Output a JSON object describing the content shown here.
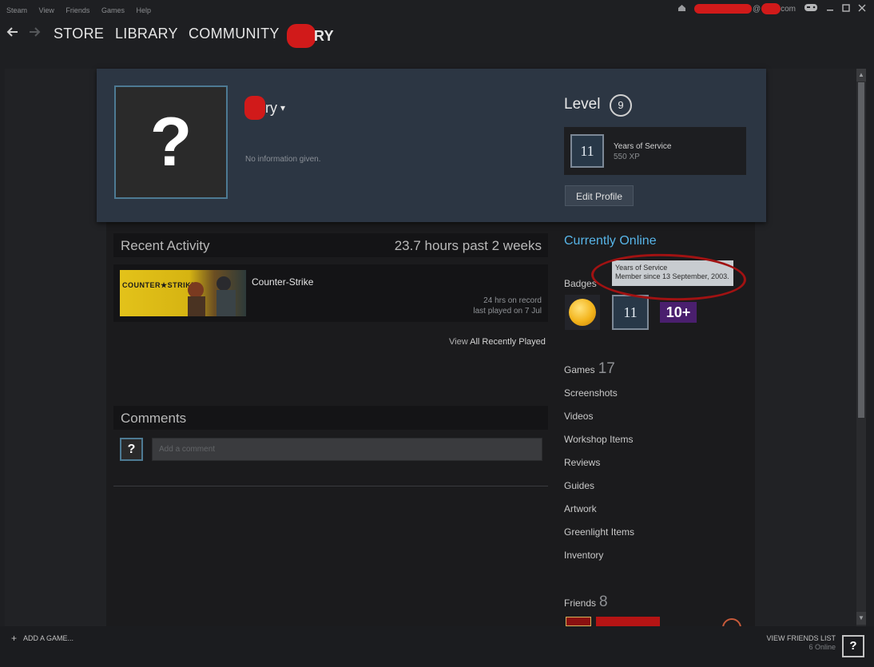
{
  "menu": {
    "items": [
      "Steam",
      "View",
      "Friends",
      "Games",
      "Help"
    ]
  },
  "titlebar": {
    "account_suffix": "com"
  },
  "nav": {
    "store": "STORE",
    "library": "LIBRARY",
    "community": "COMMUNITY",
    "profile_suffix": "RY"
  },
  "profile": {
    "avatar_glyph": "?",
    "persona_suffix": "ry",
    "dropdown_glyph": "▾",
    "info": "No information given.",
    "level_label": "Level",
    "level_value": "9",
    "badge": {
      "icon_text": "11",
      "name": "Years of Service",
      "xp": "550 XP"
    },
    "edit_button": "Edit Profile"
  },
  "recent_activity": {
    "title": "Recent Activity",
    "summary": "23.7 hours past 2 weeks",
    "games": [
      {
        "logo_text": "COUNTER★STRIKE",
        "name": "Counter-Strike",
        "hours": "24 hrs on record",
        "last_played": "last played on 7 Jul"
      }
    ],
    "view_prefix": "View",
    "view_link": "All Recently Played"
  },
  "comments": {
    "title": "Comments",
    "avatar_glyph": "?",
    "placeholder": "Add a comment"
  },
  "sidebar": {
    "status": "Currently Online",
    "badges_label": "Badges",
    "tooltip_line1": "Years of Service",
    "tooltip_line2": "Member since 13 September, 2003.",
    "badge_years": "11",
    "badge_tenplus": "10+",
    "games_label": "Games",
    "games_count": "17",
    "links": [
      "Screenshots",
      "Videos",
      "Workshop Items",
      "Reviews",
      "Guides",
      "Artwork",
      "Greenlight Items",
      "Inventory"
    ],
    "friends_label": "Friends",
    "friends_count": "8"
  },
  "bottom": {
    "add_game": "ADD A GAME...",
    "add_icon": "+",
    "view_friends": "VIEW FRIENDS LIST",
    "online_count": "6 Online",
    "friends_avatar_glyph": "?"
  },
  "icons": [
    "back-arrow-icon",
    "forward-arrow-icon",
    "notification-icon",
    "controller-icon",
    "minimize-icon",
    "maximize-icon",
    "close-icon"
  ],
  "colors": {
    "accent_blue": "#57b5e8",
    "header_card": "#2c3643",
    "redaction": "#d11a1a",
    "annotation_red": "#a11212"
  }
}
